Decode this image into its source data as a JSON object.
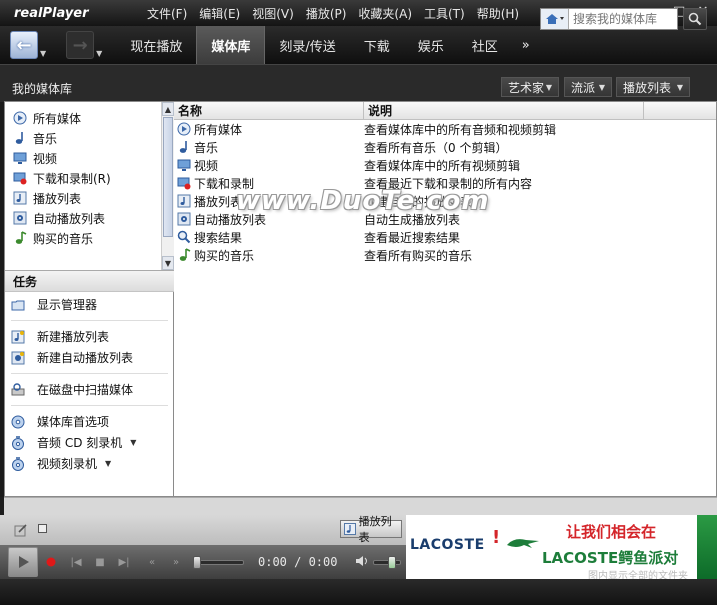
{
  "app": {
    "logo": "realPlayer"
  },
  "menu": [
    "文件(F)",
    "编辑(E)",
    "视图(V)",
    "播放(P)",
    "收藏夹(A)",
    "工具(T)",
    "帮助(H)"
  ],
  "window_controls": {
    "minimize": "▬",
    "maximize": "□",
    "close": "✕"
  },
  "nav": {
    "tabs": [
      "现在播放",
      "媒体库",
      "刻录/传送",
      "下载",
      "娱乐",
      "社区"
    ],
    "active_tab": "媒体库",
    "more": "»",
    "search_placeholder": "搜索我的媒体库"
  },
  "subheader": {
    "title": "我的媒体库",
    "filters": [
      "艺术家",
      "流派",
      "播放列表"
    ]
  },
  "library_list": [
    {
      "label": "所有媒体",
      "icon": "all-media-icon"
    },
    {
      "label": "音乐",
      "icon": "music-note-icon"
    },
    {
      "label": "视频",
      "icon": "video-monitor-icon"
    },
    {
      "label": "下载和录制(R)",
      "icon": "download-record-icon"
    },
    {
      "label": "播放列表",
      "icon": "playlist-icon"
    },
    {
      "label": "自动播放列表",
      "icon": "auto-playlist-icon"
    },
    {
      "label": "购买的音乐",
      "icon": "purchased-music-icon"
    }
  ],
  "tasks": {
    "header": "任务",
    "items": [
      {
        "label": "显示管理器",
        "icon": "folder-icon"
      },
      {
        "label": "新建播放列表",
        "icon": "new-playlist-icon"
      },
      {
        "label": "新建自动播放列表",
        "icon": "new-auto-playlist-icon"
      },
      {
        "label": "在磁盘中扫描媒体",
        "icon": "scan-disk-icon"
      },
      {
        "label": "媒体库首选项",
        "icon": "cd-preferences-icon"
      },
      {
        "label": "音频 CD 刻录机",
        "icon": "cd-burner-icon"
      },
      {
        "label": "视频刻录机",
        "icon": "video-burner-icon"
      }
    ]
  },
  "table": {
    "columns": [
      "名称",
      "说明"
    ],
    "rows": [
      {
        "name": "所有媒体",
        "desc": "查看媒体库中的所有音频和视频剪辑",
        "icon": "all-media-icon"
      },
      {
        "name": "音乐",
        "desc": "查看所有音乐（0 个剪辑）",
        "icon": "music-note-icon"
      },
      {
        "name": "视频",
        "desc": "查看媒体库中的所有视频剪辑",
        "icon": "video-monitor-icon"
      },
      {
        "name": "下载和录制",
        "desc": "查看最近下载和录制的所有内容",
        "icon": "download-record-icon"
      },
      {
        "name": "播放列表",
        "desc": "创建自己的播放列表",
        "icon": "playlist-icon"
      },
      {
        "name": "自动播放列表",
        "desc": "自动生成播放列表",
        "icon": "auto-playlist-icon"
      },
      {
        "name": "搜索结果",
        "desc": "查看最近搜索结果",
        "icon": "search-icon"
      },
      {
        "name": "购买的音乐",
        "desc": "查看所有购买的音乐",
        "icon": "purchased-music-icon"
      }
    ]
  },
  "watermark": "www.DuoTe.com",
  "player": {
    "playlist_button": "播放列表",
    "time": "0:00 / 0:00"
  },
  "ad": {
    "brand": "LACOSTE",
    "exclaim": "!",
    "line1": "让我们相会在",
    "line2": "LACOSTE鳄鱼派对",
    "footer": "图内显示全部的文件夹"
  }
}
